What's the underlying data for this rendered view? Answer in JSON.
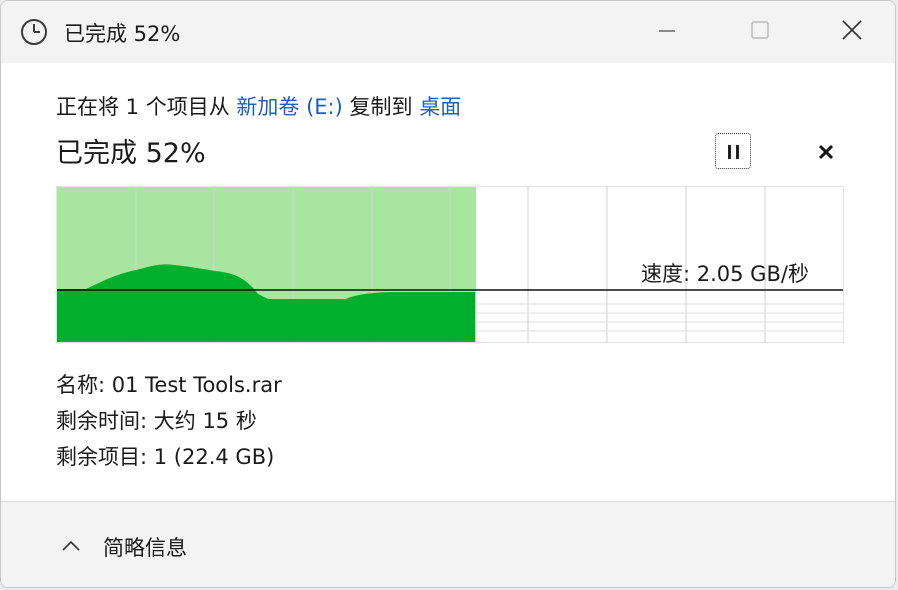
{
  "window": {
    "title": "已完成 52%",
    "icon": "clock-icon"
  },
  "copy_line": {
    "prefix": "正在将 1 个项目从",
    "source": "新加卷 (E:)",
    "middle": "复制到",
    "destination": "桌面"
  },
  "progress": {
    "title": "已完成 52%",
    "percent": 52
  },
  "speed": {
    "label": "速度: 2.05 GB/秒"
  },
  "details": {
    "name_label": "名称:",
    "name_value": "01 Test Tools.rar",
    "time_label": "剩余时间:",
    "time_value": "大约 15 秒",
    "items_label": "剩余项目:",
    "items_value": "1 (22.4 GB)"
  },
  "footer": {
    "toggle_label": "简略信息"
  },
  "colors": {
    "progress_fill": "#a8e6a0",
    "speed_fill": "#00b02c",
    "link": "#1f5fbf"
  }
}
